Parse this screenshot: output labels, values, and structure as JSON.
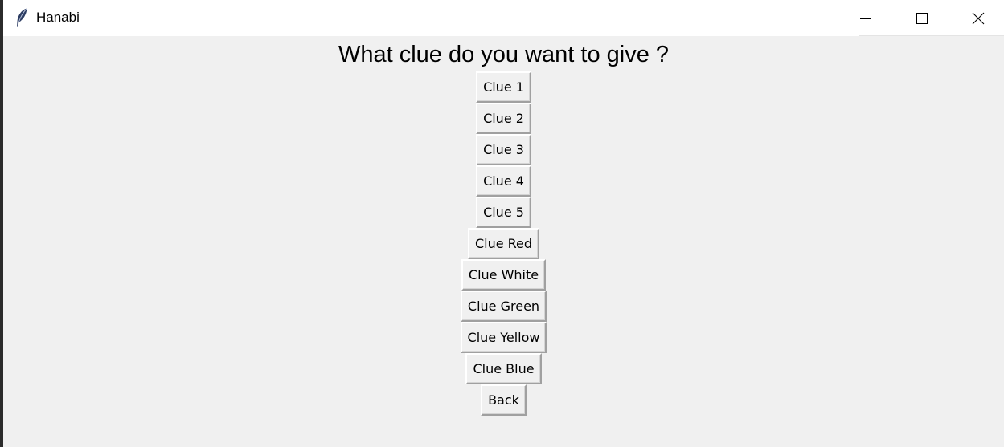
{
  "window": {
    "title": "Hanabi",
    "icon": "feather-icon",
    "controls": [
      "minimize-icon",
      "maximize-icon",
      "close-icon"
    ]
  },
  "prompt": "What clue do you want to give ?",
  "buttons": [
    {
      "label": "Clue 1"
    },
    {
      "label": "Clue 2"
    },
    {
      "label": "Clue 3"
    },
    {
      "label": "Clue 4"
    },
    {
      "label": "Clue 5"
    },
    {
      "label": "Clue Red"
    },
    {
      "label": "Clue White"
    },
    {
      "label": "Clue Green"
    },
    {
      "label": "Clue Yellow"
    },
    {
      "label": "Clue Blue"
    },
    {
      "label": "Back"
    }
  ],
  "colors": {
    "window_bg": "#f0f0f0",
    "titlebar_bg": "#ffffff"
  }
}
